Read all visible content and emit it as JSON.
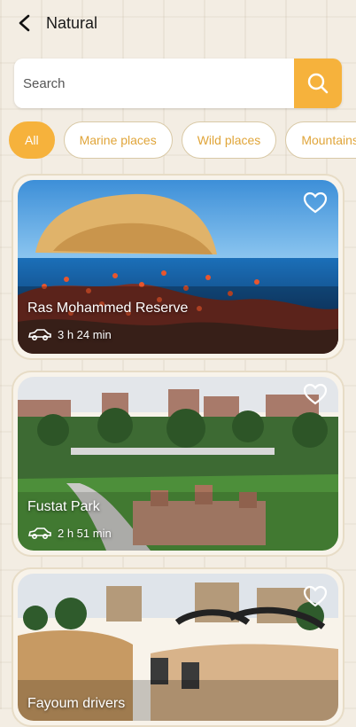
{
  "header": {
    "title": "Natural"
  },
  "search": {
    "placeholder": "Search"
  },
  "chips": [
    "All",
    "Marine places",
    "Wild places",
    "Mountains"
  ],
  "places": [
    {
      "name": "Ras Mohammed Reserve",
      "duration": "3 h 24 min"
    },
    {
      "name": "Fustat Park",
      "duration": "2 h 51 min"
    },
    {
      "name": "Fayoum drivers",
      "duration": ""
    }
  ],
  "colors": {
    "accent": "#f6b23c",
    "chip_border": "#d9c9a6",
    "chip_text": "#e0a53a"
  }
}
